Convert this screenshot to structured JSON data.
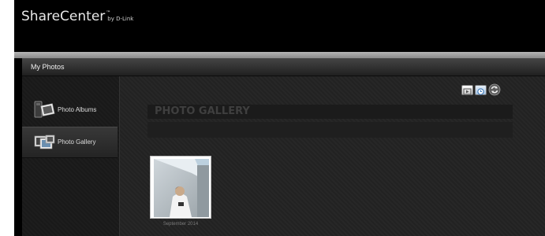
{
  "brand": {
    "name": "ShareCenter",
    "trademark": "™",
    "sub": "by D-Link"
  },
  "window": {
    "title": "My Photos"
  },
  "nav": {
    "items": [
      {
        "label": "Photo Albums",
        "icon": "photo-albums-icon",
        "active": false
      },
      {
        "label": "Photo Gallery",
        "icon": "photo-gallery-icon",
        "active": true
      }
    ]
  },
  "toolbar": {
    "buttons": [
      {
        "icon": "slideshow-icon"
      },
      {
        "icon": "clock-icon"
      },
      {
        "icon": "refresh-icon"
      }
    ]
  },
  "gallery": {
    "title": "PHOTO GALLERY",
    "items": [
      {
        "caption": "September 2014"
      }
    ]
  },
  "colors": {
    "background": "#000000",
    "panel": "#262626",
    "title_text": "#3f3f3f",
    "caption": "#7a7a7a"
  }
}
